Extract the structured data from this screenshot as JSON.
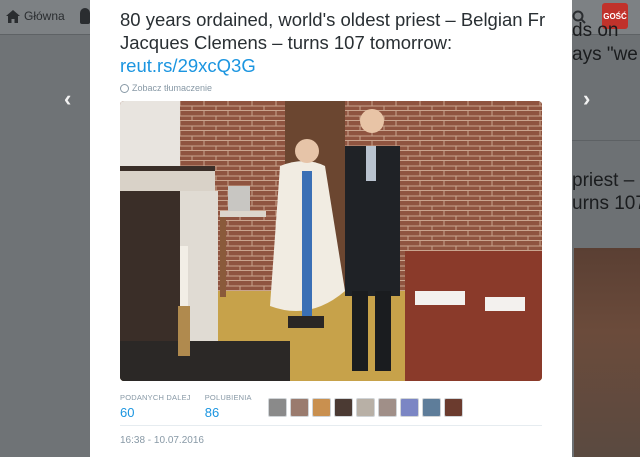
{
  "background": {
    "nav_home_label": "Główna",
    "avatar_label": "GOŚĆ",
    "right_fragments": [
      "ds on",
      "ays \"we",
      "priest –",
      "urns 107"
    ]
  },
  "tweet": {
    "text": "80 years ordained, world's oldest priest – Belgian Fr Jacques Clemens – turns 107 tomorrow: ",
    "link": "reut.rs/29xcQ3G",
    "translate_label": "Zobacz tłumaczenie",
    "photo_alt": "Elderly priest in vestments walking beside a younger man in a suit"
  },
  "stats": {
    "retweets_label": "PODANYCH DALEJ",
    "retweets_value": "60",
    "likes_label": "POLUBIENIA",
    "likes_value": "86"
  },
  "liker_colors": [
    "#8a8a8a",
    "#9a7b6e",
    "#c9904f",
    "#4b3a33",
    "#b8b0a6",
    "#a08f88",
    "#7b86c4",
    "#5e7d9a",
    "#6b3b2e"
  ],
  "timestamp": "16:38 - 10.07.2016"
}
